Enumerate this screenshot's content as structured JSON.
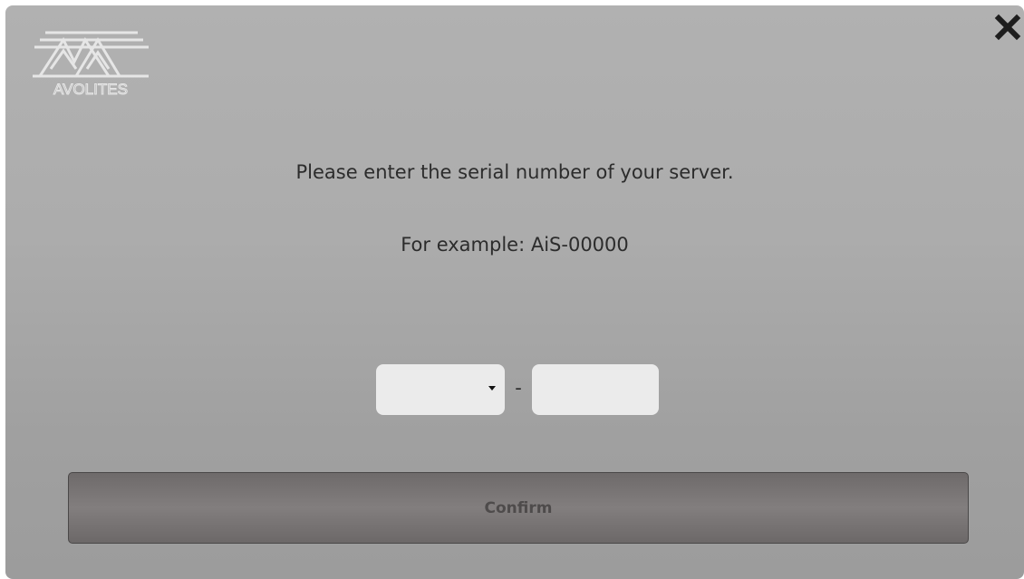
{
  "brand": {
    "logo_text": "AVOLITES"
  },
  "dialog": {
    "close_icon": "close-icon",
    "message_primary": "Please enter the serial number of your server.",
    "message_example": "For example: AiS-00000"
  },
  "serial": {
    "prefix_value": "",
    "separator": "-",
    "number_value": "",
    "number_placeholder": ""
  },
  "actions": {
    "confirm_label": "Confirm"
  },
  "colors": {
    "dialog_background": "#acacac",
    "field_background": "#ebebeb",
    "button_background": "#7a7676",
    "button_text": "#4e4b4b",
    "text": "#2c2c2c"
  }
}
